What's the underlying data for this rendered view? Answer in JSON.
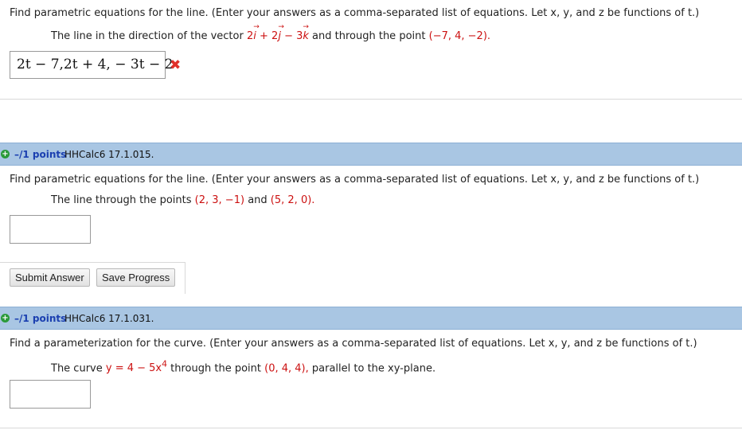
{
  "q1": {
    "prompt": "Find parametric equations for the line. (Enter your answers as a comma-separated list of equations. Let x, y, and z be functions of t.)",
    "sub_pre": "The line in the direction of the vector",
    "vec_i_coef": "2",
    "vec_i": "i",
    "vec_j_coef": "+ 2",
    "vec_j": "j",
    "vec_k_coef": "− 3",
    "vec_k": "k",
    "sub_mid": "and through the point",
    "point": "(−7, 4, −2).",
    "answer": "2t − 7,2t + 4, − 3t − 2",
    "status_icon": "incorrect-x-icon"
  },
  "q2": {
    "points": "–/1 points",
    "id": "HHCalc6 17.1.015.",
    "prompt": "Find parametric equations for the line. (Enter your answers as a comma-separated list of equations. Let x, y, and z be functions of t.)",
    "sub_pre": "The line through the points",
    "point_a": "(2, 3, −1)",
    "sub_and": "and",
    "point_b": "(5, 2, 0).",
    "answer": "",
    "submit_label": "Submit Answer",
    "save_label": "Save Progress"
  },
  "q3": {
    "points": "–/1 points",
    "id": "HHCalc6 17.1.031.",
    "prompt": "Find a parameterization for the curve. (Enter your answers as a comma-separated list of equations. Let x, y, and z be functions of t.)",
    "sub_pre": "The curve",
    "curve": "y = 4 − 5x",
    "exp": "4",
    "sub_mid": "through the point",
    "point": "(0, 4, 4),",
    "sub_post": "parallel to the xy-plane.",
    "answer": ""
  },
  "colors": {
    "header_bg": "#a9c6e3",
    "points_text": "#1a3fb0",
    "math_red": "#cc1111",
    "wrong_x": "#e0302a"
  }
}
